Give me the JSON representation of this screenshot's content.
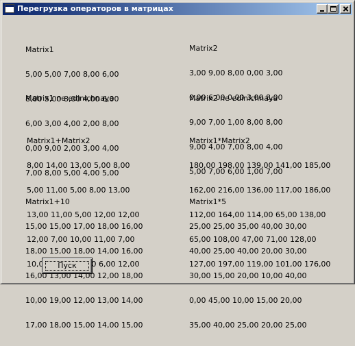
{
  "window": {
    "title": "Перегрузка операторов в матрицах"
  },
  "matrix1": {
    "label": "Matrix1",
    "rows": [
      "5,00 5,00 7,00 8,00 6,00",
      "8,00 5,00 8,00 4,00 6,00",
      "6,00 3,00 4,00 2,00 8,00",
      "0,00 9,00 2,00 3,00 4,00",
      "7,00 8,00 5,00 4,00 5,00"
    ]
  },
  "matrix2": {
    "label": "Matrix2",
    "rows": [
      "3,00 9,00 8,00 0,00 3,00",
      "0,00 6,00 0,00 3,00 8,00",
      "9,00 7,00 1,00 8,00 8,00",
      "9,00 4,00 7,00 8,00 4,00",
      "5,00 7,00 6,00 1,00 7,00"
    ]
  },
  "status": {
    "matrix1": "Matrix1 ne edinichnaya",
    "matrix2": "Matrix2 ne edinichnaya"
  },
  "sum": {
    "label": "Matrix1+Matrix2",
    "rows": [
      "8,00 14,00 13,00 5,00 8,00",
      "5,00 11,00 5,00 8,00 13,00",
      "13,00 11,00 5,00 12,00 12,00",
      "12,00 7,00 10,00 11,00 7,00",
      "10,00 12,00 11,00 6,00 12,00"
    ]
  },
  "product": {
    "label": "Matrix1*Matrix2",
    "rows": [
      "180,00 198,00 139,00 141,00 185,00",
      "162,00 216,00 136,00 117,00 186,00",
      "112,00 164,00 114,00 65,00 138,00",
      "65,00 108,00 47,00 71,00 128,00",
      "127,00 197,00 119,00 101,00 176,00"
    ]
  },
  "plus10": {
    "label": "Matrix1+10",
    "rows": [
      "15,00 15,00 17,00 18,00 16,00",
      "18,00 15,00 18,00 14,00 16,00",
      "16,00 13,00 14,00 12,00 18,00",
      "10,00 19,00 12,00 13,00 14,00",
      "17,00 18,00 15,00 14,00 15,00"
    ]
  },
  "times5": {
    "label": "Matrix1*5",
    "rows": [
      "25,00 25,00 35,00 40,00 30,00",
      "40,00 25,00 40,00 20,00 30,00",
      "30,00 15,00 20,00 10,00 40,00",
      "0,00 45,00 10,00 15,00 20,00",
      "35,00 40,00 25,00 20,00 25,00"
    ]
  },
  "button": {
    "label": "Пуск"
  }
}
